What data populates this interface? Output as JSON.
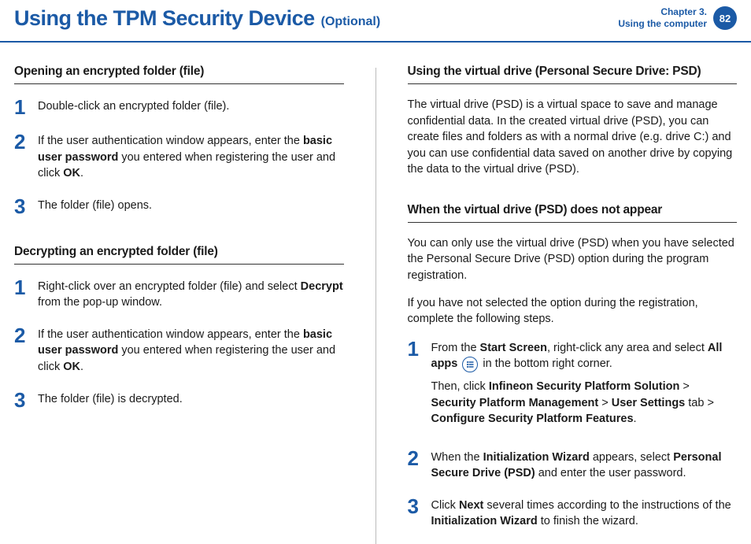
{
  "header": {
    "title": "Using the TPM Security Device",
    "subtitle": "(Optional)",
    "chapter_line1": "Chapter 3.",
    "chapter_line2": "Using the computer",
    "page": "82"
  },
  "left": {
    "section1_head": "Opening an encrypted folder (file)",
    "s1_step1": "Double-click an encrypted folder (file).",
    "s1_step2_a": "If the user authentication window appears, enter the ",
    "s1_step2_b": "basic user password",
    "s1_step2_c": " you entered when registering the user and click ",
    "s1_step2_d": "OK",
    "s1_step2_e": ".",
    "s1_step3": "The folder (file) opens.",
    "section2_head": "Decrypting an encrypted folder (file)",
    "s2_step1_a": "Right-click over an encrypted folder (file) and select ",
    "s2_step1_b": "Decrypt",
    "s2_step1_c": " from the pop-up window.",
    "s2_step2_a": "If the user authentication window appears, enter the ",
    "s2_step2_b": "basic user password",
    "s2_step2_c": " you entered when registering the user and click ",
    "s2_step2_d": "OK",
    "s2_step2_e": ".",
    "s2_step3": "The folder (file) is decrypted."
  },
  "right": {
    "section1_head": "Using the virtual drive (Personal Secure Drive: PSD)",
    "s1_para": "The virtual drive (PSD) is a virtual space to save and manage confidential data. In the created virtual drive (PSD), you can create files and folders as with a normal drive (e.g. drive C:) and you can use confidential data saved on another drive by copying the data to the virtual drive (PSD).",
    "section2_head": "When the virtual drive (PSD) does not appear",
    "s2_para1": "You can only use the virtual drive (PSD) when you have selected the Personal Secure Drive (PSD) option during the program registration.",
    "s2_para2": " If you have not selected the option during the registration, complete the following steps.",
    "s2_step1_a": "From the ",
    "s2_step1_b": "Start Screen",
    "s2_step1_c": ", right-click any area and select ",
    "s2_step1_d": "All apps",
    "s2_step1_e": " in the bottom right corner.",
    "s2_step1_p2_a": "Then, click ",
    "s2_step1_p2_b": "Infineon Security Platform Solution",
    "s2_step1_p2_c": " > ",
    "s2_step1_p2_d": "Security Platform Management",
    "s2_step1_p2_e": " > ",
    "s2_step1_p2_f": "User Settings",
    "s2_step1_p2_g": " tab > ",
    "s2_step1_p2_h": "Configure Security Platform Features",
    "s2_step1_p2_i": ".",
    "s2_step2_a": "When the ",
    "s2_step2_b": "Initialization Wizard",
    "s2_step2_c": " appears, select ",
    "s2_step2_d": "Personal Secure Drive (PSD)",
    "s2_step2_e": " and enter the user password.",
    "s2_step3_a": "Click ",
    "s2_step3_b": "Next",
    "s2_step3_c": " several times according to the instructions of the ",
    "s2_step3_d": "Initialization Wizard",
    "s2_step3_e": " to finish the wizard."
  },
  "nums": {
    "n1": "1",
    "n2": "2",
    "n3": "3"
  }
}
